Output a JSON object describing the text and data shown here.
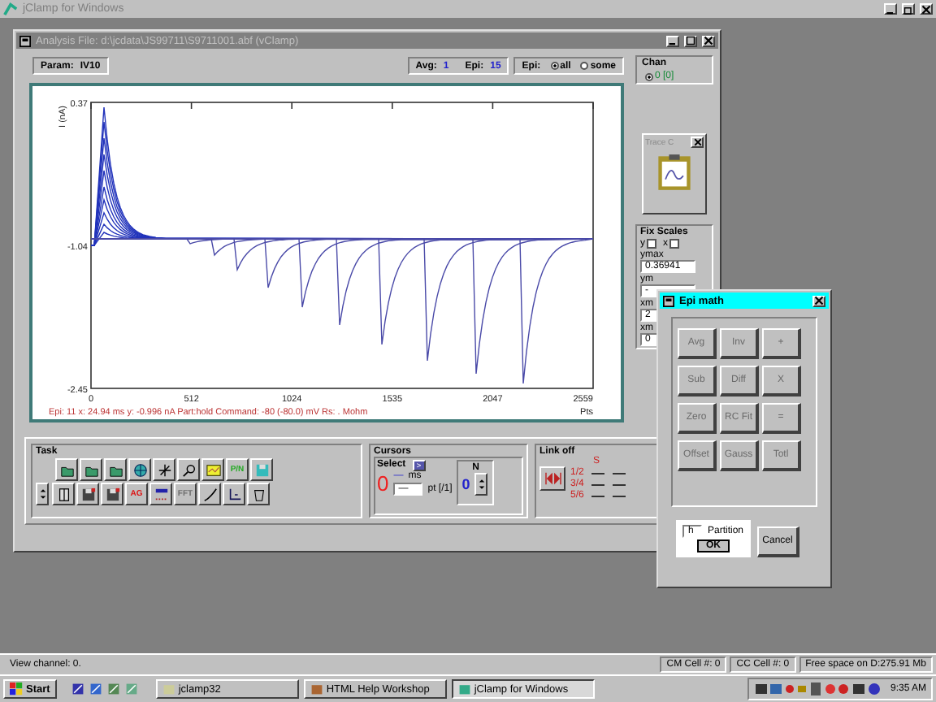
{
  "app": {
    "title": "jClamp for Windows"
  },
  "analysis": {
    "title": "Analysis  File: d:\\jcdata\\JS99711\\S9711001.abf (vClamp)",
    "param_label": "Param:",
    "param_value": "IV10",
    "avg_label": "Avg:",
    "avg_value": "1",
    "epi_label": "Epi:",
    "epi_value": "15",
    "mode_label": "Epi:",
    "modes": [
      {
        "label": "all",
        "selected": true
      },
      {
        "label": "some",
        "selected": false
      }
    ]
  },
  "chart": {
    "y_title": "I (nA)",
    "y_labels": [
      "0.37",
      "-1.04",
      "-2.45"
    ],
    "x_labels": [
      "0",
      "512",
      "1024",
      "1535",
      "2047",
      "2559"
    ],
    "x_unit": "Pts",
    "readout": "Epi: 11  x: 24.94 ms  y: -0.996 nA  Part:hold  Command: -80 (-80.0) mV  Rs: . Mohm"
  },
  "chan": {
    "title": "Chan",
    "channels": [
      {
        "label": "0 [0]",
        "selected": true
      }
    ]
  },
  "trace_panel": {
    "title": "Trace C"
  },
  "fix_scales": {
    "title": "Fix Scales",
    "axes": [
      {
        "label": "y",
        "checked": false
      },
      {
        "label": "x",
        "checked": false
      }
    ],
    "fields": [
      {
        "label": "ymax",
        "value": "0.36941"
      },
      {
        "label": "ym",
        "value": "-"
      },
      {
        "label": "xm",
        "value": "2"
      },
      {
        "label": "xm",
        "value": "0"
      }
    ]
  },
  "task": {
    "title": "Task",
    "buttons": [
      {
        "kind": "icon",
        "disabled": false
      },
      {
        "kind": "icon",
        "disabled": false
      },
      {
        "kind": "icon",
        "disabled": false
      },
      {
        "kind": "icon",
        "disabled": false
      },
      {
        "kind": "icon",
        "disabled": false
      },
      {
        "kind": "icon",
        "disabled": false
      },
      {
        "kind": "icon",
        "disabled": false
      },
      {
        "kind": "text",
        "label": "P/N",
        "disabled": false
      },
      {
        "kind": "icon",
        "disabled": false
      },
      {
        "kind": "icon",
        "disabled": false
      },
      {
        "kind": "icon",
        "disabled": false
      },
      {
        "kind": "icon",
        "disabled": false
      },
      {
        "kind": "text",
        "label": "AG",
        "disabled": false
      },
      {
        "kind": "icon",
        "disabled": false
      },
      {
        "kind": "text",
        "label": "FFT",
        "disabled": true
      },
      {
        "kind": "icon",
        "disabled": false
      },
      {
        "kind": "icon",
        "disabled": false
      },
      {
        "kind": "icon",
        "disabled": false
      }
    ]
  },
  "cursors": {
    "title": "Cursors",
    "select_label": "Select",
    "select_button": ">",
    "cursor_value": "0",
    "ms_value": "—",
    "ms_unit": "ms",
    "pt_value": "—",
    "pt_unit": "pt [/1]",
    "n_label": "N",
    "n_value": "0"
  },
  "link": {
    "title": "Link off",
    "mark": "S",
    "ratios": [
      "1/2",
      "3/4",
      "5/6"
    ]
  },
  "epi_math": {
    "title": "Epi math",
    "buttons": [
      {
        "label": "Avg",
        "disabled": true
      },
      {
        "label": "Inv",
        "disabled": true
      },
      {
        "label": "+",
        "disabled": true
      },
      {
        "label": "Sub",
        "disabled": true
      },
      {
        "label": "Diff",
        "disabled": true
      },
      {
        "label": "X",
        "disabled": true
      },
      {
        "label": "Zero",
        "disabled": true
      },
      {
        "label": "RC Fit",
        "disabled": true
      },
      {
        "label": "=",
        "disabled": true
      },
      {
        "label": "Offset",
        "disabled": true
      },
      {
        "label": "Gauss",
        "disabled": true
      },
      {
        "label": "Totl",
        "disabled": true
      }
    ],
    "partition_value": "h",
    "partition_label": "Partition",
    "ok": "OK",
    "cancel": "Cancel"
  },
  "status_bar": [
    "View channel: 0.",
    "CM Cell #: 0",
    "CC Cell #: 0",
    "Free space on D:275.91 Mb"
  ],
  "taskbar": {
    "start": "Start",
    "tasks": [
      {
        "label": "jclamp32",
        "selected": false
      },
      {
        "label": "HTML Help Workshop",
        "selected": false
      },
      {
        "label": "jClamp for Windows",
        "selected": true
      }
    ],
    "clock": "9:35 AM"
  }
}
